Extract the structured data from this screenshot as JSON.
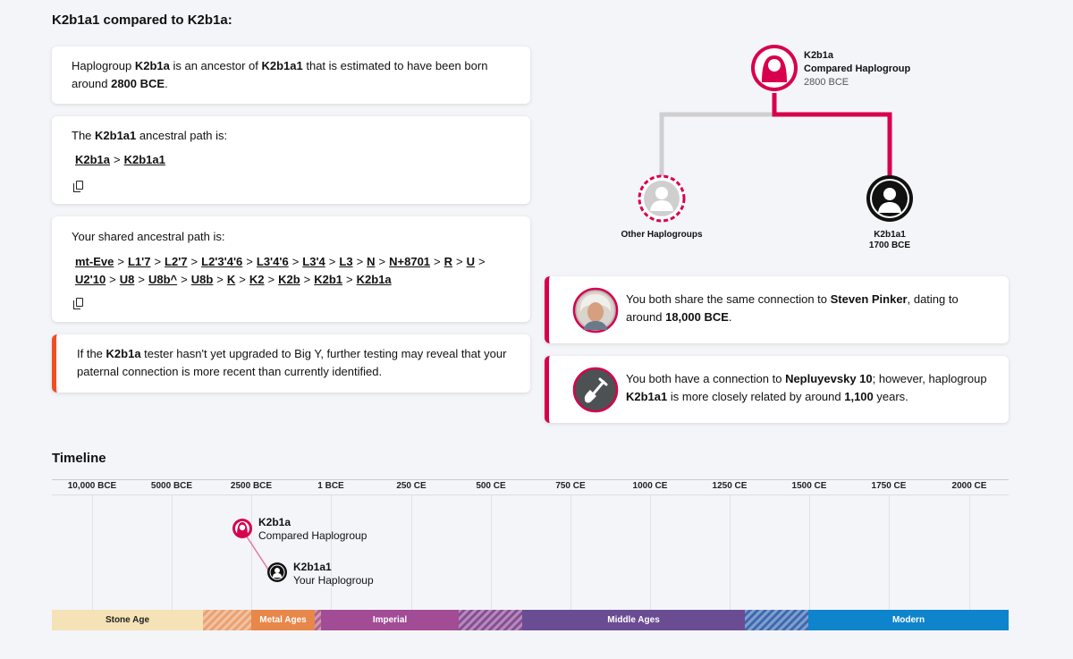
{
  "title": "K2b1a1 compared to K2b1a:",
  "card1": {
    "t1": "Haplogroup ",
    "b1": "K2b1a",
    "t2": " is an ancestor of ",
    "b2": "K2b1a1",
    "t3": " that is estimated to have been born around ",
    "b3": "2800 BCE",
    "t4": "."
  },
  "card2": {
    "t1": "The ",
    "b1": "K2b1a1",
    "t2": " ancestral path is:",
    "path": [
      "K2b1a",
      "K2b1a1"
    ]
  },
  "card3": {
    "label": "Your shared ancestral path is:",
    "line1": [
      "mt-Eve",
      "L1'7",
      "L2'7",
      "L2'3'4'6",
      "L3'4'6",
      "L3'4",
      "L3",
      "N",
      "N+8701",
      "R",
      "U"
    ],
    "line2": [
      "U2'10",
      "U8",
      "U8b^",
      "U8b",
      "K",
      "K2",
      "K2b",
      "K2b1",
      "K2b1a"
    ]
  },
  "card4": {
    "t1": "If the ",
    "b1": "K2b1a",
    "t2": " tester hasn't yet upgraded to Big Y, further testing may reveal that your paternal connection is more recent than currently identified."
  },
  "tree": {
    "top_name": "K2b1a",
    "top_sub": "Compared Haplogroup",
    "top_date": "2800 BCE",
    "left_label": "Other Haplogroups",
    "right_name": "K2b1a1",
    "right_date": "1700 BCE"
  },
  "notable1": {
    "t1": "You both share the same connection to ",
    "b1": "Steven Pinker",
    "t2": ", dating to around ",
    "b2": "18,000 BCE",
    "t3": "."
  },
  "notable2": {
    "t1": "You both have a connection to ",
    "b1": "Nepluyevsky 10",
    "t2": "; however, haplogroup ",
    "b2": "K2b1a1",
    "t3": " is more closely related by around ",
    "b3": "1,100",
    "t4": " years."
  },
  "timeline": {
    "title": "Timeline",
    "ticks": [
      "10,000 BCE",
      "5000 BCE",
      "2500 BCE",
      "1 BCE",
      "250 CE",
      "500 CE",
      "750 CE",
      "1000 CE",
      "1250 CE",
      "1500 CE",
      "1750 CE",
      "2000 CE"
    ],
    "m1_name": "K2b1a",
    "m1_sub": "Compared Haplogroup",
    "m2_name": "K2b1a1",
    "m2_sub": "Your Haplogroup",
    "ages": [
      "Stone Age",
      "Metal Ages",
      "Imperial",
      "Middle Ages",
      "Modern"
    ]
  },
  "colors": {
    "accent": "#d8004c",
    "warning": "#f04e23",
    "stone": "#f5e2b6",
    "metal": "#e8874a",
    "imperial": "#a14c95",
    "middle": "#6a4c93",
    "modern": "#0e84cc"
  },
  "icons": [
    "copy-icon",
    "avatar-female-icon",
    "avatar-male-icon",
    "shovel-icon"
  ]
}
